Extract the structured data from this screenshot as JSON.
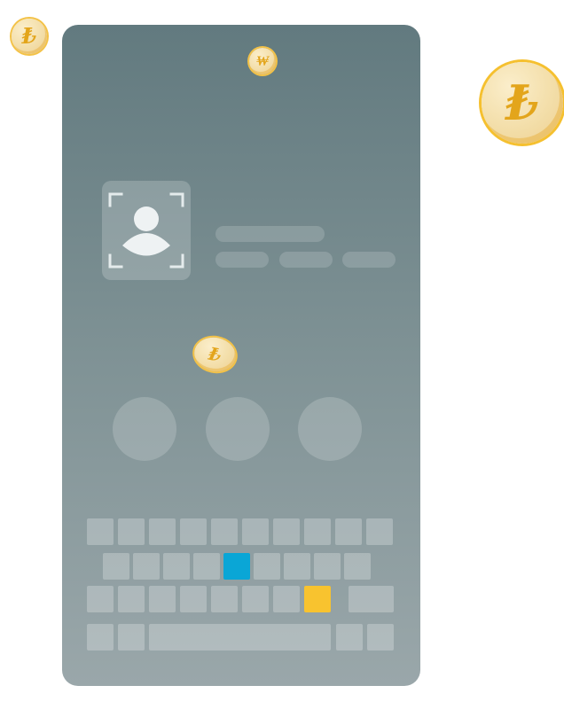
{
  "coins": [
    {
      "id": "coin-top-left",
      "symbol": "₺"
    },
    {
      "id": "coin-top",
      "symbol": "₩"
    },
    {
      "id": "coin-right",
      "symbol": "₺"
    },
    {
      "id": "coin-middle",
      "symbol": "₺"
    }
  ],
  "colors": {
    "phone_gradient_top": "#627a7f",
    "phone_gradient_bottom": "#9aa7aa",
    "coin_gold": "#e3a51b",
    "key_highlight_blue": "#0aa6d6",
    "key_highlight_yellow": "#f8c32f"
  },
  "icons": {
    "avatar": "user-silhouette-icon",
    "scan_frame": "scan-frame-icon"
  }
}
